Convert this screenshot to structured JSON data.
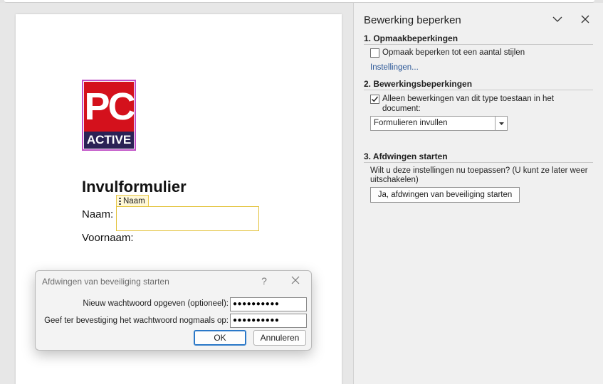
{
  "document": {
    "logo_top": "PC",
    "logo_bottom": "ACTIVE",
    "title": "Invulformulier",
    "content_control_tag": "Naam",
    "label_naam": "Naam:",
    "label_voornaam": "Voornaam:"
  },
  "dialog": {
    "title": "Afdwingen van beveiliging starten",
    "help": "?",
    "new_password_label": "Nieuw wachtwoord opgeven (optioneel):",
    "new_password_value": "●●●●●●●●●●",
    "confirm_password_label": "Geef ter bevestiging het wachtwoord nogmaals op:",
    "confirm_password_value": "●●●●●●●●●●",
    "ok_label": "OK",
    "cancel_label": "Annuleren"
  },
  "pane": {
    "title": "Bewerking beperken",
    "section1": {
      "heading": "1. Opmaakbeperkingen",
      "checkbox_label": "Opmaak beperken tot een aantal stijlen",
      "checked": false,
      "settings_link": "Instellingen..."
    },
    "section2": {
      "heading": "2. Bewerkingsbeperkingen",
      "checkbox_label": "Alleen bewerkingen van dit type toestaan in het document:",
      "checked": true,
      "select_value": "Formulieren invullen"
    },
    "section3": {
      "heading": "3. Afdwingen starten",
      "description": "Wilt u deze instellingen nu toepassen? (U kunt ze later weer uitschakelen)",
      "button_label": "Ja, afdwingen van beveiliging starten"
    }
  },
  "colors": {
    "logo_red": "#d4111c",
    "logo_navy": "#2b2255",
    "content_control_border": "#e3c23b",
    "link": "#2b5797",
    "ok_focus": "#2a78c8"
  }
}
